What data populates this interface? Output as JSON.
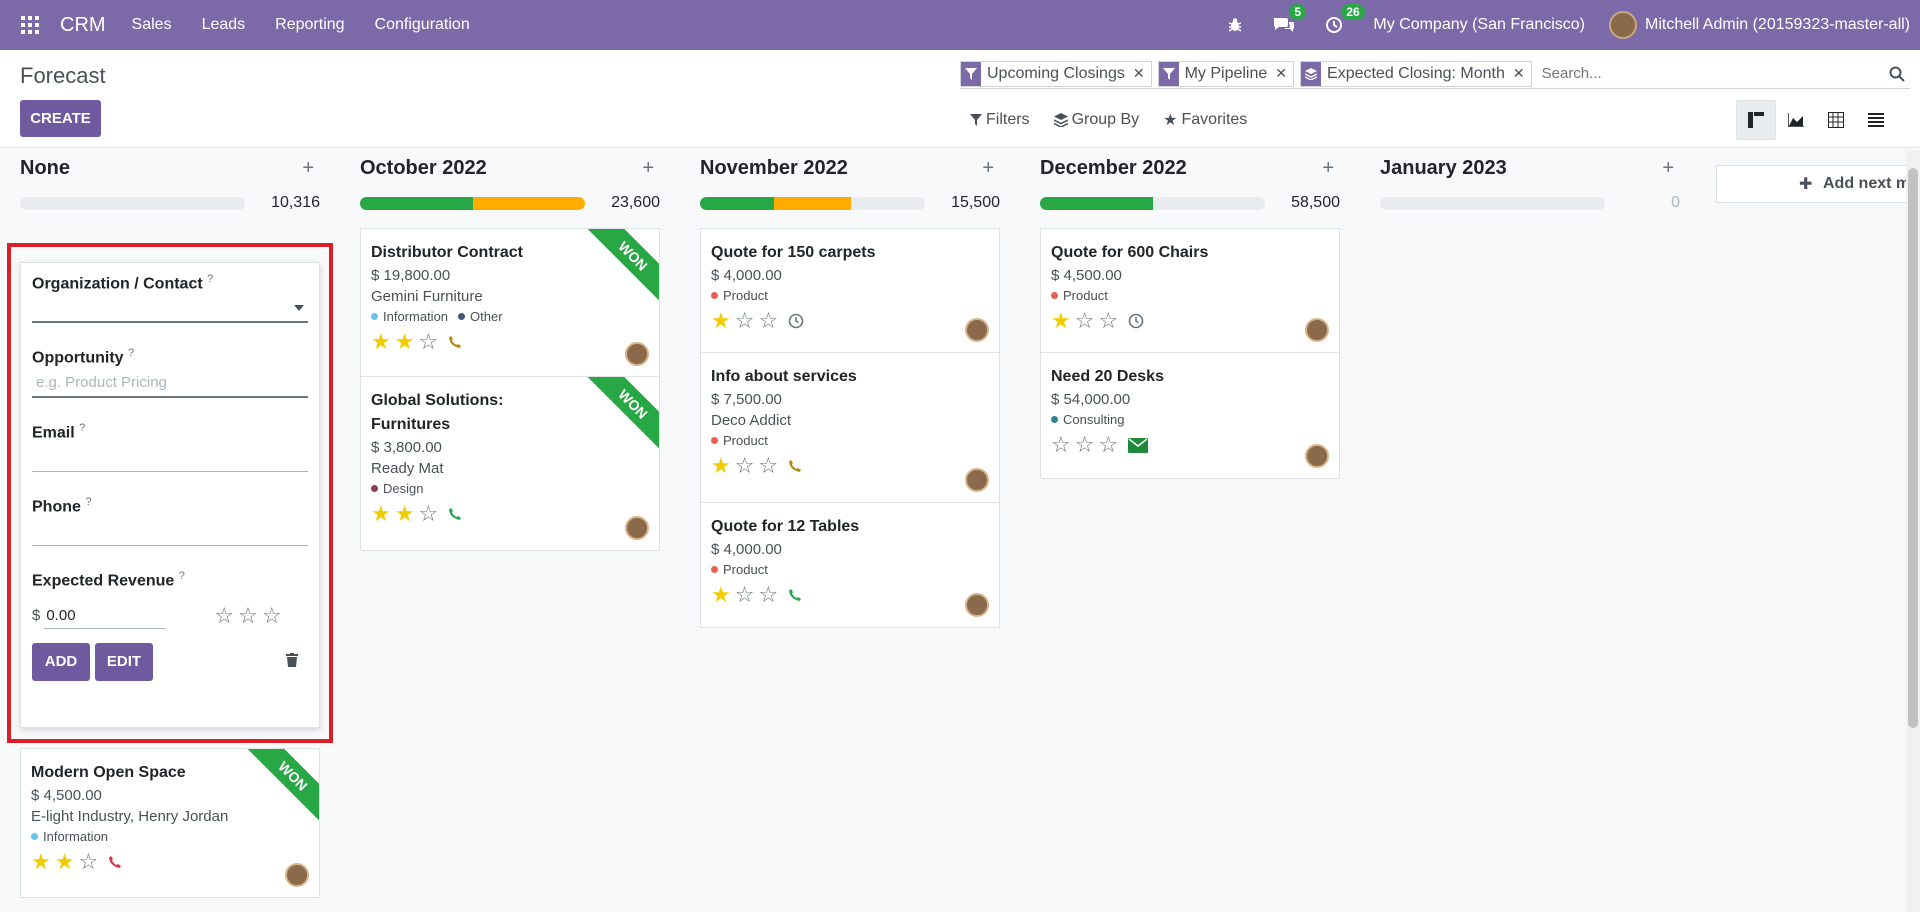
{
  "topbar": {
    "brand": "CRM",
    "menus": [
      "Sales",
      "Leads",
      "Reporting",
      "Configuration"
    ],
    "messages_count": "5",
    "activities_count": "26",
    "company": "My Company (San Francisco)",
    "user": "Mitchell Admin (20159323-master-all)"
  },
  "control": {
    "title": "Forecast",
    "create_label": "CREATE",
    "facets": [
      "Upcoming Closings",
      "My Pipeline",
      "Expected Closing: Month"
    ],
    "search_placeholder": "Search...",
    "filters_label": "Filters",
    "groupby_label": "Group By",
    "favorites_label": "Favorites"
  },
  "columns": [
    {
      "title": "None",
      "total": "10,316",
      "green": 0,
      "orange": 0
    },
    {
      "title": "October 2022",
      "total": "23,600",
      "green": 0.5,
      "orange": 0.5
    },
    {
      "title": "November 2022",
      "total": "15,500",
      "green": 0.33,
      "orange": 0.34
    },
    {
      "title": "December 2022",
      "total": "58,500",
      "green": 0.5,
      "orange": 0
    },
    {
      "title": "January 2023",
      "total": "0",
      "green": 0,
      "orange": 0
    }
  ],
  "quick_create": {
    "org_label": "Organization / Contact",
    "opportunity_label": "Opportunity",
    "opportunity_placeholder": "e.g. Product Pricing",
    "email_label": "Email",
    "phone_label": "Phone",
    "revenue_label": "Expected Revenue",
    "currency": "$",
    "revenue_value": "0.00",
    "add_label": "ADD",
    "edit_label": "EDIT",
    "help_mark": "?"
  },
  "cards": {
    "none_0": {
      "name": "Modern Open Space",
      "amount": "$ 4,500.00",
      "customer": "E-light Industry, Henry Jordan",
      "tags": [
        "Information"
      ],
      "ribbon": "WON",
      "stars": 2
    },
    "oct_0": {
      "name": "Distributor Contract",
      "amount": "$ 19,800.00",
      "customer": "Gemini Furniture",
      "tags": [
        "Information",
        "Other"
      ],
      "ribbon": "WON",
      "stars": 2
    },
    "oct_1": {
      "name": "Global Solutions: Furnitures",
      "amount": "$ 3,800.00",
      "customer": "Ready Mat",
      "tags": [
        "Design"
      ],
      "ribbon": "WON",
      "stars": 2
    },
    "nov_0": {
      "name": "Quote for 150 carpets",
      "amount": "$ 4,000.00",
      "tags": [
        "Product"
      ],
      "stars": 1
    },
    "nov_1": {
      "name": "Info about services",
      "amount": "$ 7,500.00",
      "customer": "Deco Addict",
      "tags": [
        "Product"
      ],
      "stars": 1
    },
    "nov_2": {
      "name": "Quote for 12 Tables",
      "amount": "$ 4,000.00",
      "tags": [
        "Product"
      ],
      "stars": 1
    },
    "dec_0": {
      "name": "Quote for 600 Chairs",
      "amount": "$ 4,500.00",
      "tags": [
        "Product"
      ],
      "stars": 1
    },
    "dec_1": {
      "name": "Need 20 Desks",
      "amount": "$ 54,000.00",
      "tags": [
        "Consulting"
      ],
      "stars": 0
    }
  },
  "add_next_label": "Add next m",
  "colors": {
    "brand": "#7c6aa8",
    "button": "#6f5aa0",
    "won": "#28a745",
    "progress_orange": "#ffac00",
    "highlight": "#dc1e28"
  },
  "icons": [
    "apps-grid-icon",
    "bug-icon",
    "chat-icon",
    "clock-icon",
    "filter-icon",
    "layers-icon",
    "star-icon",
    "search-icon",
    "kanban-icon",
    "graph-icon",
    "pivot-icon",
    "list-icon",
    "phone-icon",
    "envelope-icon",
    "trash-icon"
  ]
}
